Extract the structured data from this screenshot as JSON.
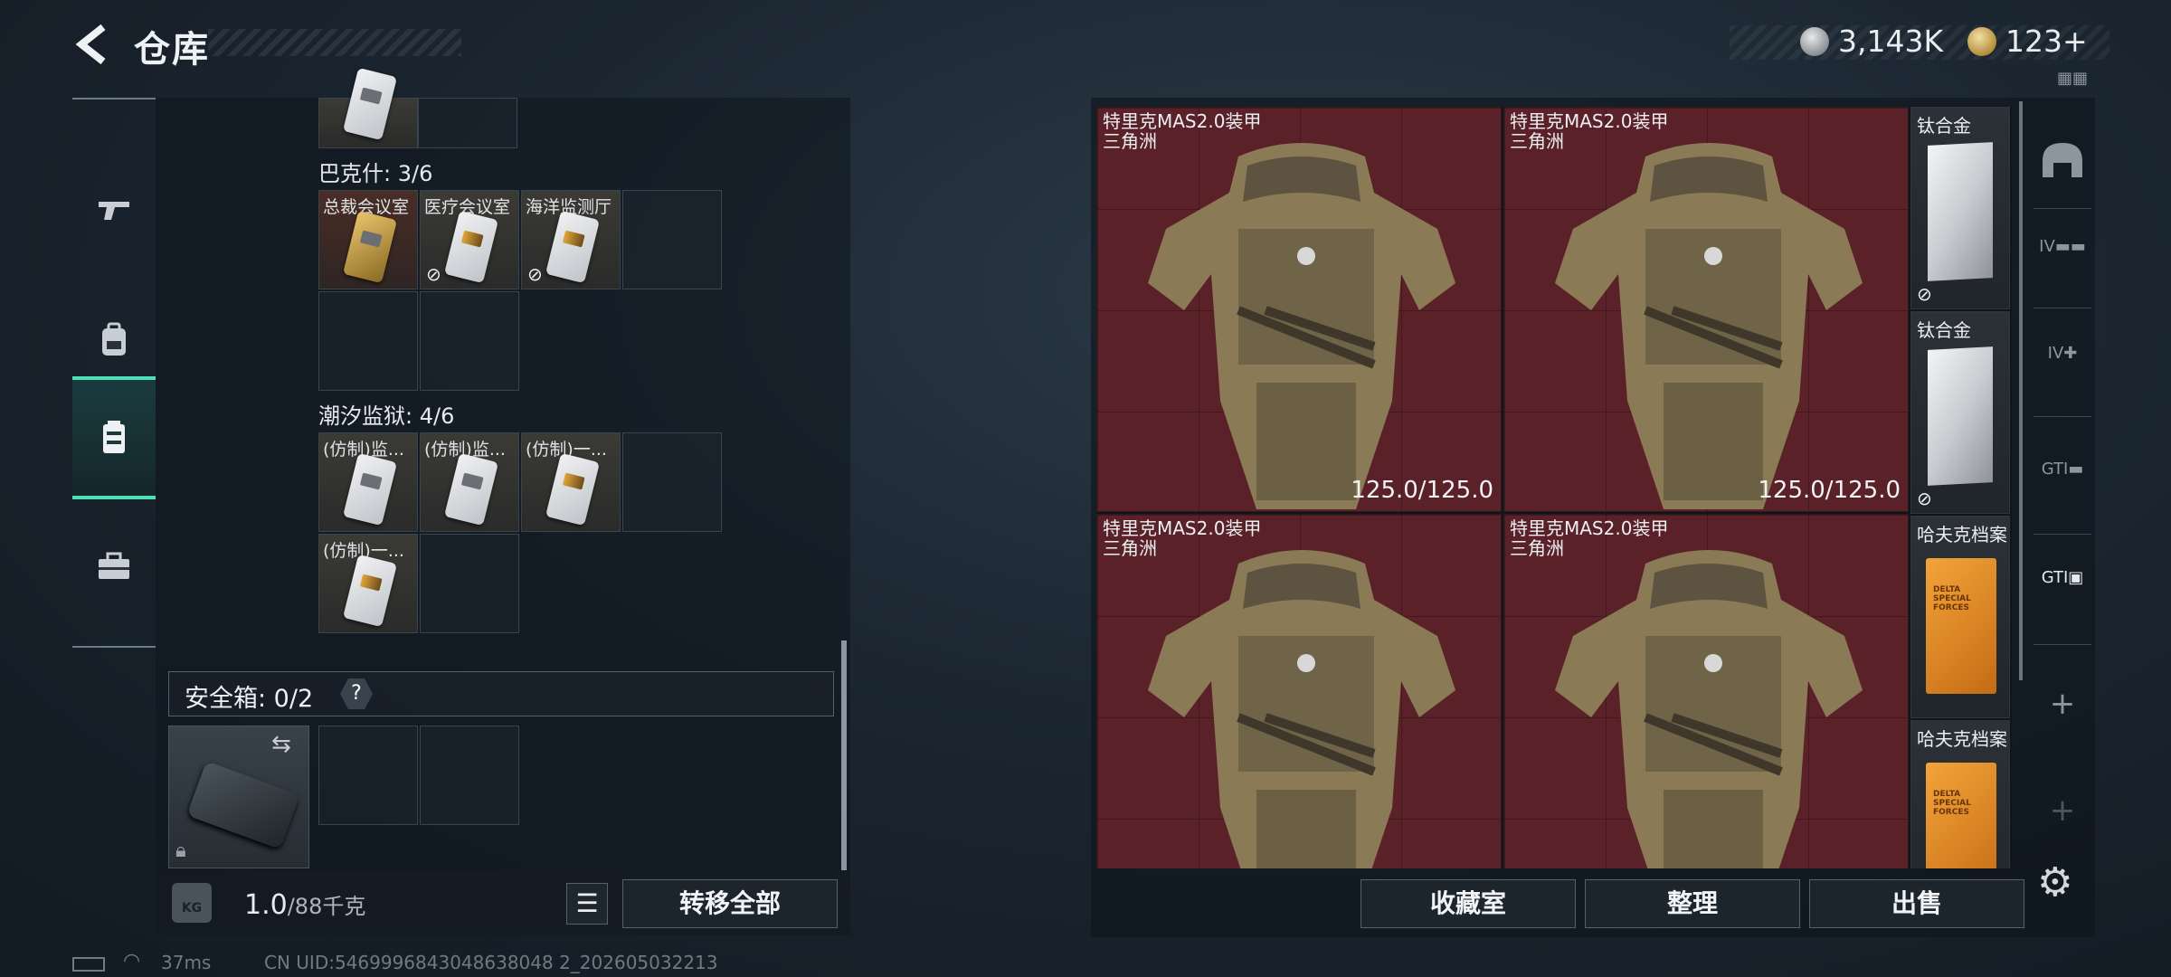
{
  "header": {
    "title": "仓库",
    "currency_silver": "3,143K",
    "currency_gold": "123",
    "currency_add": "+"
  },
  "nav": {
    "items": [
      {
        "name": "weapon-icon"
      },
      {
        "name": "backpack-icon"
      },
      {
        "name": "stash-icon"
      },
      {
        "name": "toolbox-icon"
      }
    ],
    "active_index": 2
  },
  "left": {
    "sections": [
      {
        "title": "巴克什: 3/6",
        "items": [
          {
            "label": "总裁会议室"
          },
          {
            "label": "医疗会议室"
          },
          {
            "label": "海洋监测厅"
          }
        ]
      },
      {
        "title": "潮汐监狱: 4/6",
        "items": [
          {
            "label": "(仿制)监..."
          },
          {
            "label": "(仿制)监..."
          },
          {
            "label": "(仿制)一..."
          },
          {
            "label": "(仿制)一..."
          }
        ]
      }
    ],
    "safebox_label": "安全箱: 0/2",
    "safebox_help": "?",
    "weight_value": "1.0",
    "weight_max": "/88千克",
    "weight_icon_text": "KG",
    "transfer_all": "转移全部"
  },
  "right": {
    "armors": [
      {
        "name": "特里克MAS2.0装甲",
        "origin": "三角洲",
        "durability": "125.0/125.0"
      },
      {
        "name": "特里克MAS2.0装甲",
        "origin": "三角洲",
        "durability": "125.0/125.0"
      },
      {
        "name": "特里克MAS2.0装甲",
        "origin": "三角洲",
        "durability": ""
      },
      {
        "name": "特里克MAS2.0装甲",
        "origin": "三角洲",
        "durability": ""
      }
    ],
    "small_items": [
      {
        "name": "钛合金"
      },
      {
        "name": "钛合金"
      },
      {
        "name": "哈夫克档案"
      },
      {
        "name": "哈夫克档案"
      }
    ],
    "buttons": {
      "collection": "收藏室",
      "organize": "整理",
      "sell": "出售"
    }
  },
  "status": {
    "ping": "37ms",
    "uid": "CN UID:5469996843048638048 2_202605032213"
  }
}
